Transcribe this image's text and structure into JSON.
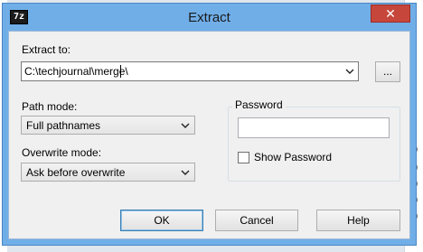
{
  "window": {
    "title": "Extract",
    "icon_text": "7z",
    "close_glyph": "✕"
  },
  "extract_to": {
    "label": "Extract to:",
    "value": "C:\\techjournal\\merge\\",
    "browse_label": "..."
  },
  "path_mode": {
    "label": "Path mode:",
    "selected": "Full pathnames"
  },
  "overwrite_mode": {
    "label": "Overwrite mode:",
    "selected": "Ask before overwrite"
  },
  "password": {
    "group_label": "Password",
    "value": "",
    "show_password_label": "Show Password",
    "show_password_checked": false
  },
  "buttons": {
    "ok": "OK",
    "cancel": "Cancel",
    "help": "Help"
  },
  "background_glyphs": [
    "0",
    "0",
    "0",
    "0",
    "0"
  ]
}
